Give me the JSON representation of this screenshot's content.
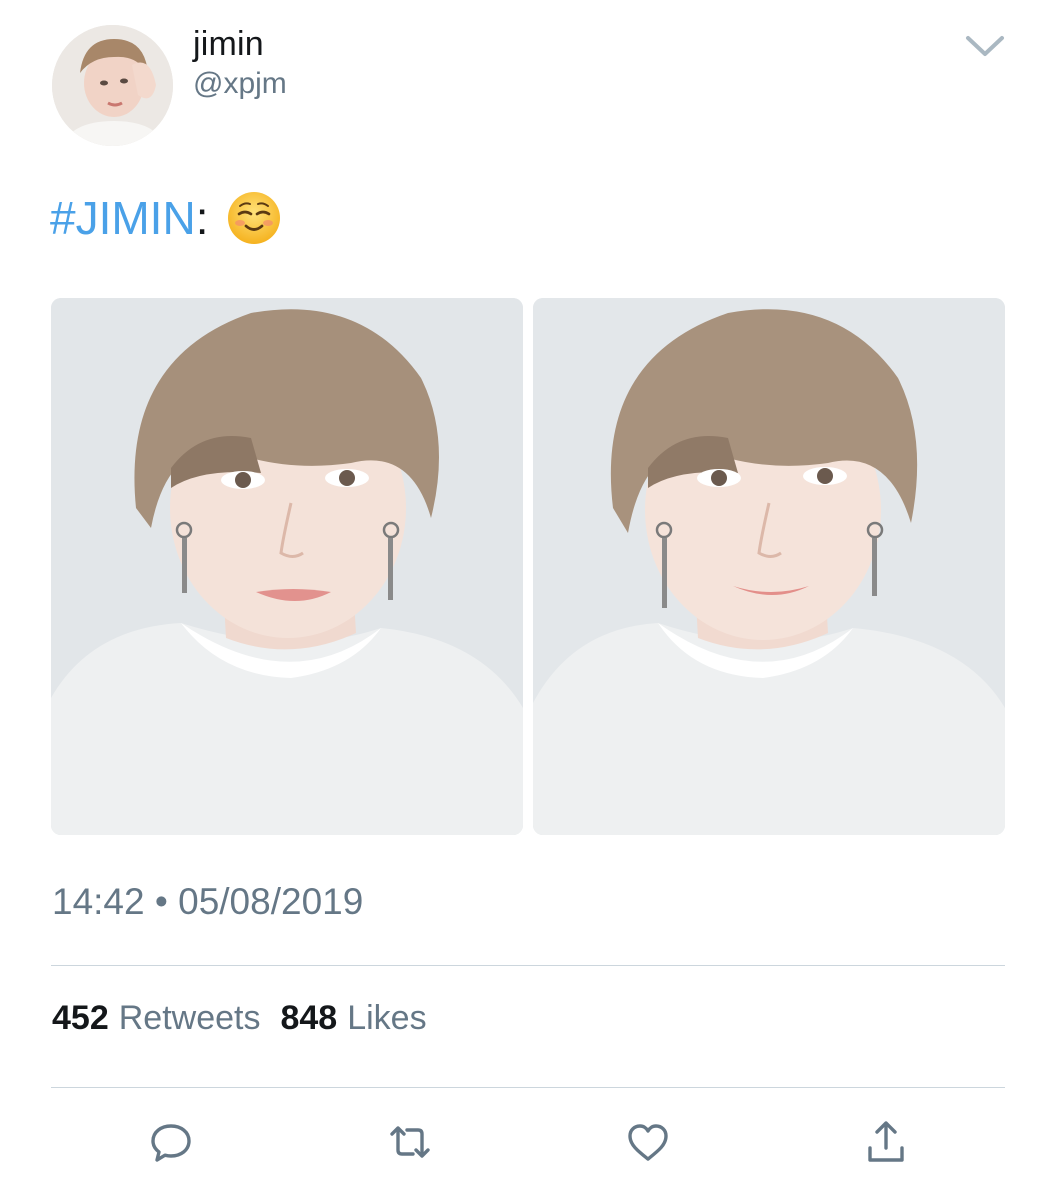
{
  "author": {
    "display_name": "jimin",
    "handle": "@xpjm",
    "avatar_icon": "profile-photo"
  },
  "tweet": {
    "hashtag": "#JIMIN",
    "separator": ":",
    "emoji": "☺️",
    "media": [
      {
        "name": "photo-1",
        "description_icon": "selfie-photo"
      },
      {
        "name": "photo-2",
        "description_icon": "selfie-photo"
      }
    ]
  },
  "meta": {
    "time": "14:42",
    "dot": "•",
    "date": "05/08/2019"
  },
  "stats": {
    "retweets_count": "452",
    "retweets_label": "Retweets",
    "likes_count": "848",
    "likes_label": "Likes"
  },
  "actions": {
    "reply_icon": "reply-icon",
    "retweet_icon": "retweet-icon",
    "like_icon": "heart-icon",
    "share_icon": "share-icon"
  },
  "colors": {
    "hashtag": "#4aa1e8",
    "secondary_text": "#657786",
    "primary_text": "#14171a",
    "divider": "#ccd6dd",
    "icon": "#657786"
  }
}
